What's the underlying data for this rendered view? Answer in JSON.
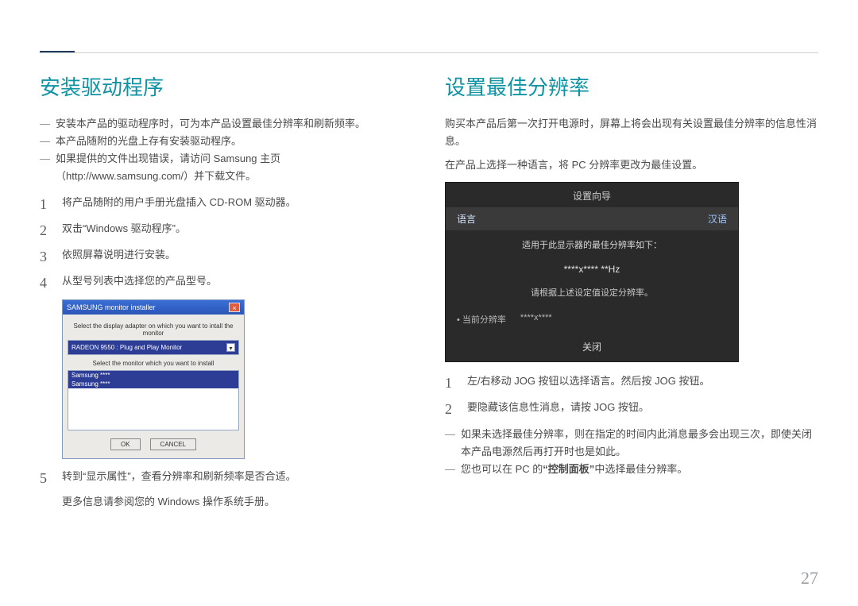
{
  "page_number": "27",
  "left": {
    "heading": "安装驱动程序",
    "dashes": [
      "安装本产品的驱动程序时，可为本产品设置最佳分辨率和刷新频率。",
      "本产品随附的光盘上存有安装驱动程序。",
      "如果提供的文件出现错误，请访问 Samsung 主页（http://www.samsung.com/）并下载文件。"
    ],
    "steps_a": [
      "将产品随附的用户手册光盘插入 CD-ROM 驱动器。",
      "双击“Windows 驱动程序”。",
      "依照屏幕说明进行安装。",
      "从型号列表中选择您的产品型号。"
    ],
    "installer": {
      "title": "SAMSUNG monitor installer",
      "prompt1": "Select the display adapter on which you want to intall the monitor",
      "select_value": "RADEON 9550 : Plug and Play Monitor",
      "prompt2": "Select the monitor which you want to install",
      "list_rows": [
        "Samsung ****",
        "Samsung ****"
      ],
      "ok": "OK",
      "cancel": "CANCEL"
    },
    "step5": "转到“显示属性”，查看分辨率和刷新频率是否合适。",
    "more_info": "更多信息请参阅您的 Windows 操作系统手册。"
  },
  "right": {
    "heading": "设置最佳分辨率",
    "intro1": "购买本产品后第一次打开电源时，屏幕上将会出现有关设置最佳分辨率的信息性消息。",
    "intro2": "在产品上选择一种语言，将 PC 分辨率更改为最佳设置。",
    "osd": {
      "title": "设置向导",
      "lang_label": "语言",
      "lang_value": "汉语",
      "line1": "适用于此显示器的最佳分辨率如下：",
      "res": "****x**** **Hz",
      "line2": "请根据上述设定值设定分辨率。",
      "current_label": "• 当前分辨率",
      "current_value": "****x****",
      "close": "关闭"
    },
    "steps": [
      "左/右移动 JOG 按钮以选择语言。然后按 JOG 按钮。",
      "要隐藏该信息性消息，请按 JOG 按钮。"
    ],
    "dashes": [
      "如果未选择最佳分辨率，则在指定的时间内此消息最多会出现三次，即使关闭本产品电源然后再打开时也是如此。",
      "您也可以在 PC 的“控制面板”中选择最佳分辨率。"
    ]
  }
}
